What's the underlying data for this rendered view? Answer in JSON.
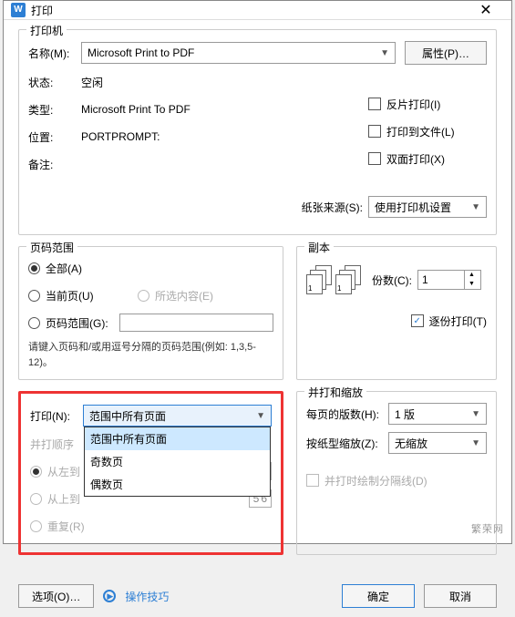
{
  "title": "打印",
  "printer_group": {
    "title": "打印机",
    "name_label": "名称(M):",
    "name_value": "Microsoft Print to PDF",
    "props_btn": "属性(P)…",
    "status_label": "状态:",
    "status_value": "空闲",
    "type_label": "类型:",
    "type_value": "Microsoft Print To PDF",
    "where_label": "位置:",
    "where_value": "PORTPROMPT:",
    "comment_label": "备注:",
    "reverse_print": "反片打印(I)",
    "print_to_file": "打印到文件(L)",
    "duplex": "双面打印(X)",
    "paper_src_label": "纸张来源(S):",
    "paper_src_value": "使用打印机设置"
  },
  "range_group": {
    "title": "页码范围",
    "all": "全部(A)",
    "current": "当前页(U)",
    "selection": "所选内容(E)",
    "pages": "页码范围(G):",
    "hint": "请键入页码和/或用逗号分隔的页码范围(例如: 1,3,5-12)。"
  },
  "copies_group": {
    "title": "副本",
    "copies_label": "份数(C):",
    "copies_value": "1",
    "collate": "逐份打印(T)"
  },
  "print_what": {
    "label": "打印(N):",
    "value": "范围中所有页面",
    "options": [
      "范围中所有页面",
      "奇数页",
      "偶数页"
    ],
    "order_label": "并打顺序",
    "lr": "从左到",
    "tb": "从上到",
    "repeat": "重复(R)"
  },
  "zoom_group": {
    "title": "并打和缩放",
    "pages_per_label": "每页的版数(H):",
    "pages_per_value": "1 版",
    "scale_label": "按纸型缩放(Z):",
    "scale_value": "无缩放",
    "draw_lines": "并打时绘制分隔线(D)"
  },
  "footer": {
    "options": "选项(O)…",
    "tips": "操作技巧",
    "ok": "确定",
    "cancel": "取消"
  },
  "watermark": "繁荣网"
}
